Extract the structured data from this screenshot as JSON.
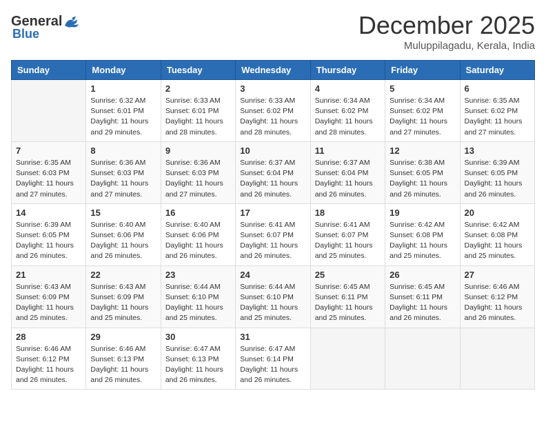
{
  "logo": {
    "general": "General",
    "blue": "Blue"
  },
  "header": {
    "month": "December 2025",
    "location": "Muluppilagadu, Kerala, India"
  },
  "weekdays": [
    "Sunday",
    "Monday",
    "Tuesday",
    "Wednesday",
    "Thursday",
    "Friday",
    "Saturday"
  ],
  "weeks": [
    [
      {
        "date": "",
        "sunrise": "",
        "sunset": "",
        "daylight": ""
      },
      {
        "date": "1",
        "sunrise": "Sunrise: 6:32 AM",
        "sunset": "Sunset: 6:01 PM",
        "daylight": "Daylight: 11 hours and 29 minutes."
      },
      {
        "date": "2",
        "sunrise": "Sunrise: 6:33 AM",
        "sunset": "Sunset: 6:01 PM",
        "daylight": "Daylight: 11 hours and 28 minutes."
      },
      {
        "date": "3",
        "sunrise": "Sunrise: 6:33 AM",
        "sunset": "Sunset: 6:02 PM",
        "daylight": "Daylight: 11 hours and 28 minutes."
      },
      {
        "date": "4",
        "sunrise": "Sunrise: 6:34 AM",
        "sunset": "Sunset: 6:02 PM",
        "daylight": "Daylight: 11 hours and 28 minutes."
      },
      {
        "date": "5",
        "sunrise": "Sunrise: 6:34 AM",
        "sunset": "Sunset: 6:02 PM",
        "daylight": "Daylight: 11 hours and 27 minutes."
      },
      {
        "date": "6",
        "sunrise": "Sunrise: 6:35 AM",
        "sunset": "Sunset: 6:02 PM",
        "daylight": "Daylight: 11 hours and 27 minutes."
      }
    ],
    [
      {
        "date": "7",
        "sunrise": "Sunrise: 6:35 AM",
        "sunset": "Sunset: 6:03 PM",
        "daylight": "Daylight: 11 hours and 27 minutes."
      },
      {
        "date": "8",
        "sunrise": "Sunrise: 6:36 AM",
        "sunset": "Sunset: 6:03 PM",
        "daylight": "Daylight: 11 hours and 27 minutes."
      },
      {
        "date": "9",
        "sunrise": "Sunrise: 6:36 AM",
        "sunset": "Sunset: 6:03 PM",
        "daylight": "Daylight: 11 hours and 27 minutes."
      },
      {
        "date": "10",
        "sunrise": "Sunrise: 6:37 AM",
        "sunset": "Sunset: 6:04 PM",
        "daylight": "Daylight: 11 hours and 26 minutes."
      },
      {
        "date": "11",
        "sunrise": "Sunrise: 6:37 AM",
        "sunset": "Sunset: 6:04 PM",
        "daylight": "Daylight: 11 hours and 26 minutes."
      },
      {
        "date": "12",
        "sunrise": "Sunrise: 6:38 AM",
        "sunset": "Sunset: 6:05 PM",
        "daylight": "Daylight: 11 hours and 26 minutes."
      },
      {
        "date": "13",
        "sunrise": "Sunrise: 6:39 AM",
        "sunset": "Sunset: 6:05 PM",
        "daylight": "Daylight: 11 hours and 26 minutes."
      }
    ],
    [
      {
        "date": "14",
        "sunrise": "Sunrise: 6:39 AM",
        "sunset": "Sunset: 6:05 PM",
        "daylight": "Daylight: 11 hours and 26 minutes."
      },
      {
        "date": "15",
        "sunrise": "Sunrise: 6:40 AM",
        "sunset": "Sunset: 6:06 PM",
        "daylight": "Daylight: 11 hours and 26 minutes."
      },
      {
        "date": "16",
        "sunrise": "Sunrise: 6:40 AM",
        "sunset": "Sunset: 6:06 PM",
        "daylight": "Daylight: 11 hours and 26 minutes."
      },
      {
        "date": "17",
        "sunrise": "Sunrise: 6:41 AM",
        "sunset": "Sunset: 6:07 PM",
        "daylight": "Daylight: 11 hours and 26 minutes."
      },
      {
        "date": "18",
        "sunrise": "Sunrise: 6:41 AM",
        "sunset": "Sunset: 6:07 PM",
        "daylight": "Daylight: 11 hours and 25 minutes."
      },
      {
        "date": "19",
        "sunrise": "Sunrise: 6:42 AM",
        "sunset": "Sunset: 6:08 PM",
        "daylight": "Daylight: 11 hours and 25 minutes."
      },
      {
        "date": "20",
        "sunrise": "Sunrise: 6:42 AM",
        "sunset": "Sunset: 6:08 PM",
        "daylight": "Daylight: 11 hours and 25 minutes."
      }
    ],
    [
      {
        "date": "21",
        "sunrise": "Sunrise: 6:43 AM",
        "sunset": "Sunset: 6:09 PM",
        "daylight": "Daylight: 11 hours and 25 minutes."
      },
      {
        "date": "22",
        "sunrise": "Sunrise: 6:43 AM",
        "sunset": "Sunset: 6:09 PM",
        "daylight": "Daylight: 11 hours and 25 minutes."
      },
      {
        "date": "23",
        "sunrise": "Sunrise: 6:44 AM",
        "sunset": "Sunset: 6:10 PM",
        "daylight": "Daylight: 11 hours and 25 minutes."
      },
      {
        "date": "24",
        "sunrise": "Sunrise: 6:44 AM",
        "sunset": "Sunset: 6:10 PM",
        "daylight": "Daylight: 11 hours and 25 minutes."
      },
      {
        "date": "25",
        "sunrise": "Sunrise: 6:45 AM",
        "sunset": "Sunset: 6:11 PM",
        "daylight": "Daylight: 11 hours and 25 minutes."
      },
      {
        "date": "26",
        "sunrise": "Sunrise: 6:45 AM",
        "sunset": "Sunset: 6:11 PM",
        "daylight": "Daylight: 11 hours and 26 minutes."
      },
      {
        "date": "27",
        "sunrise": "Sunrise: 6:46 AM",
        "sunset": "Sunset: 6:12 PM",
        "daylight": "Daylight: 11 hours and 26 minutes."
      }
    ],
    [
      {
        "date": "28",
        "sunrise": "Sunrise: 6:46 AM",
        "sunset": "Sunset: 6:12 PM",
        "daylight": "Daylight: 11 hours and 26 minutes."
      },
      {
        "date": "29",
        "sunrise": "Sunrise: 6:46 AM",
        "sunset": "Sunset: 6:13 PM",
        "daylight": "Daylight: 11 hours and 26 minutes."
      },
      {
        "date": "30",
        "sunrise": "Sunrise: 6:47 AM",
        "sunset": "Sunset: 6:13 PM",
        "daylight": "Daylight: 11 hours and 26 minutes."
      },
      {
        "date": "31",
        "sunrise": "Sunrise: 6:47 AM",
        "sunset": "Sunset: 6:14 PM",
        "daylight": "Daylight: 11 hours and 26 minutes."
      },
      {
        "date": "",
        "sunrise": "",
        "sunset": "",
        "daylight": ""
      },
      {
        "date": "",
        "sunrise": "",
        "sunset": "",
        "daylight": ""
      },
      {
        "date": "",
        "sunrise": "",
        "sunset": "",
        "daylight": ""
      }
    ]
  ]
}
